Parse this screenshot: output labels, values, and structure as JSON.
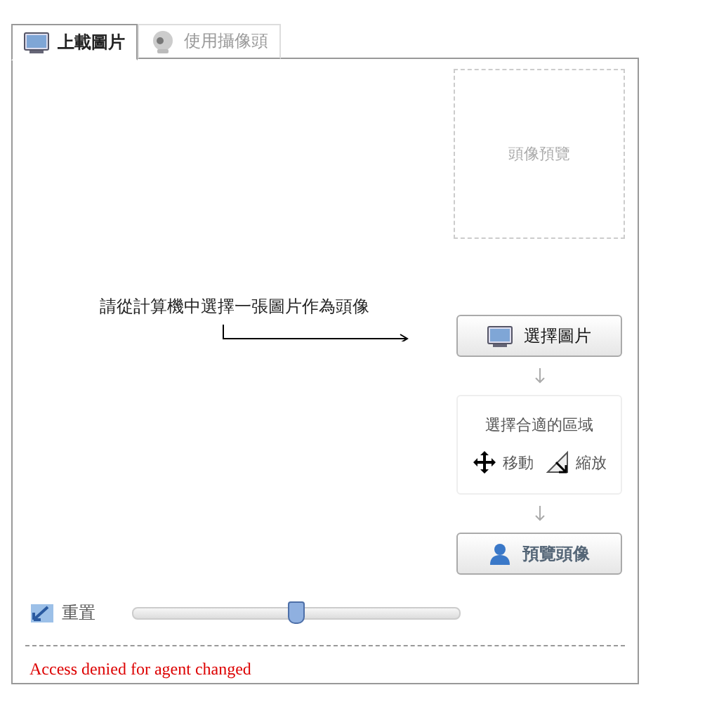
{
  "tabs": [
    {
      "label": "上載圖片",
      "selected": true
    },
    {
      "label": "使用攝像頭",
      "selected": false
    }
  ],
  "preview": {
    "label": "頭像預覽"
  },
  "instruction": "請從計算機中選擇一張圖片作為頭像",
  "select_button": "選擇圖片",
  "crop_box": {
    "title": "選擇合適的區域",
    "move": "移動",
    "zoom": "縮放"
  },
  "preview_button": "預覽頭像",
  "reset": "重置",
  "zoom_slider": {
    "level": 0.5
  },
  "error": "Access denied for agent changed"
}
